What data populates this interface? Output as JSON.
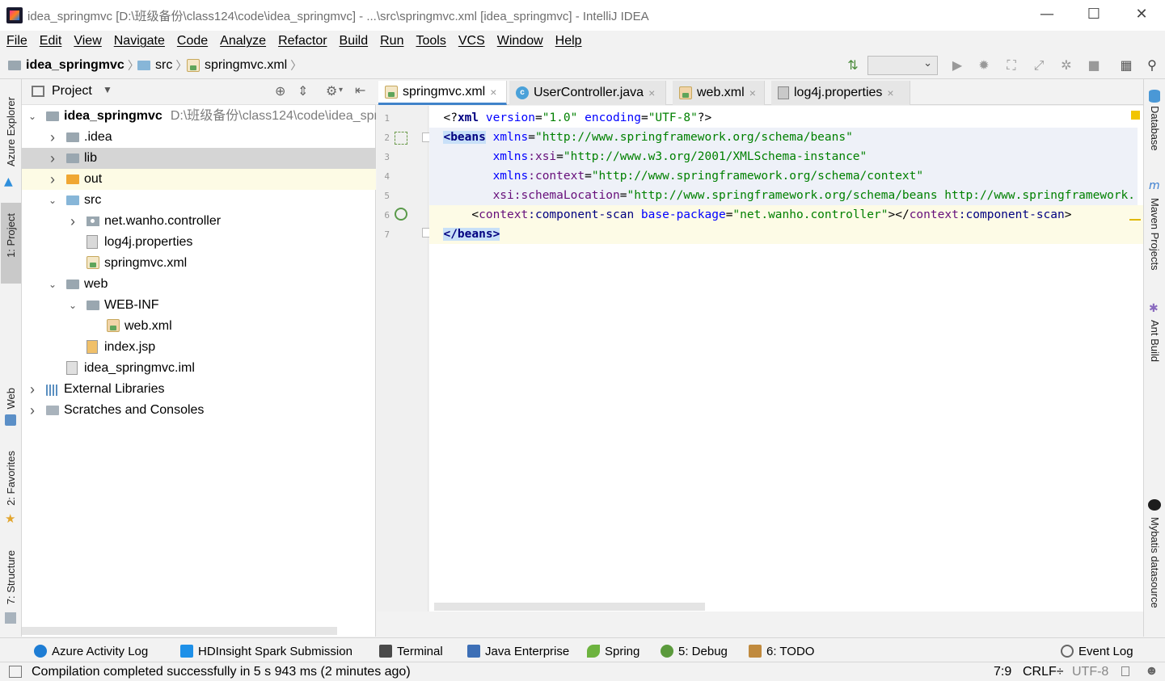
{
  "window": {
    "title": "idea_springmvc [D:\\班级备份\\class124\\code\\idea_springmvc] - ...\\src\\springmvc.xml [idea_springmvc] - IntelliJ IDEA",
    "minimize": "—",
    "maximize": "☐",
    "close": "✕"
  },
  "menu": [
    "File",
    "Edit",
    "View",
    "Navigate",
    "Code",
    "Analyze",
    "Refactor",
    "Build",
    "Run",
    "Tools",
    "VCS",
    "Window",
    "Help"
  ],
  "breadcrumb": [
    "idea_springmvc",
    "src",
    "springmvc.xml"
  ],
  "left_strip": {
    "azure": "Azure Explorer",
    "project": "1: Project",
    "web": "Web",
    "favorites": "2: Favorites",
    "structure": "7: Structure"
  },
  "right_strip": {
    "database": "Database",
    "maven": "Maven Projects",
    "ant": "Ant Build",
    "mybatis": "Mybatis datasource"
  },
  "project_panel": {
    "title": "Project",
    "tree": [
      {
        "label": "idea_springmvc",
        "path": "D:\\班级备份\\class124\\code\\idea_spri",
        "level": 0,
        "arrow": "v",
        "icon": "module"
      },
      {
        "label": ".idea",
        "level": 1,
        "arrow": ">",
        "icon": "folder-grey"
      },
      {
        "label": "lib",
        "level": 1,
        "arrow": ">",
        "icon": "folder-grey"
      },
      {
        "label": "out",
        "level": 1,
        "arrow": ">",
        "icon": "folder-orange"
      },
      {
        "label": "src",
        "level": 1,
        "arrow": "v",
        "icon": "folder-blue"
      },
      {
        "label": "net.wanho.controller",
        "level": 2,
        "arrow": ">",
        "icon": "package"
      },
      {
        "label": "log4j.properties",
        "level": 2,
        "arrow": "",
        "icon": "properties"
      },
      {
        "label": "springmvc.xml",
        "level": 2,
        "arrow": "",
        "icon": "xml"
      },
      {
        "label": "web",
        "level": 1,
        "arrow": "v",
        "icon": "folder-grey"
      },
      {
        "label": "WEB-INF",
        "level": 2,
        "arrow": "v",
        "icon": "folder-grey"
      },
      {
        "label": "web.xml",
        "level": 3,
        "arrow": "",
        "icon": "webxml"
      },
      {
        "label": "index.jsp",
        "level": 2,
        "arrow": "",
        "icon": "jsp"
      },
      {
        "label": "idea_springmvc.iml",
        "level": 1,
        "arrow": "",
        "icon": "iml"
      },
      {
        "label": "External Libraries",
        "level": 0,
        "arrow": ">",
        "icon": "libraries"
      },
      {
        "label": "Scratches and Consoles",
        "level": 0,
        "arrow": ">",
        "icon": "scratches"
      }
    ]
  },
  "editor_tabs": [
    {
      "label": "springmvc.xml",
      "icon": "xml",
      "active": true
    },
    {
      "label": "UserController.java",
      "icon": "class",
      "active": false
    },
    {
      "label": "web.xml",
      "icon": "webxml",
      "active": false
    },
    {
      "label": "log4j.properties",
      "icon": "properties",
      "active": false
    }
  ],
  "class_icon_letter": "c",
  "code": {
    "line_numbers": [
      "1",
      "2",
      "3",
      "4",
      "5",
      "6",
      "7"
    ],
    "l1": {
      "open": "<?",
      "tag": "xml",
      "a1": "version",
      "v1": "\"1.0\"",
      "a2": "encoding",
      "v2": "\"UTF-8\"",
      "close": "?>"
    },
    "l2": {
      "tag": "<beans",
      "attr": "xmlns",
      "val": "\"http://www.springframework.org/schema/beans\""
    },
    "l3": {
      "prefix": "xmlns",
      "attr": ":xsi",
      "val": "\"http://www.w3.org/2001/XMLSchema-instance\""
    },
    "l4": {
      "prefix": "xmlns",
      "attr": ":context",
      "val": "\"http://www.springframework.org/schema/context\""
    },
    "l5": {
      "prefix": "xsi",
      "attr": ":schemaLocation",
      "val": "\"http://www.springframework.org/schema/beans http://www.springframework."
    },
    "l6": {
      "open": "<",
      "prefix": "context",
      "tag": ":component-scan",
      "attr": "base-package",
      "val": "\"net.wanho.controller\"",
      "mid": "></",
      "prefix2": "context",
      "tag2": ":component-scan",
      "close": ">"
    },
    "l7": {
      "tag": "</beans",
      "close": ">"
    }
  },
  "bottom_tabs": [
    {
      "label": "Azure Activity Log",
      "color": "#1e7dd4"
    },
    {
      "label": "HDInsight Spark Submission",
      "color": "#1e90e8"
    },
    {
      "label": "Terminal",
      "color": "#4a4a4a"
    },
    {
      "label": "Java Enterprise",
      "color": "#3d6fb6"
    },
    {
      "label": "Spring",
      "color": "#6db33f"
    },
    {
      "label": "5: Debug",
      "color": "#5b9a3c"
    },
    {
      "label": "6: TODO",
      "color": "#c08a3e"
    }
  ],
  "event_log": "Event Log",
  "status": {
    "message": "Compilation completed successfully in 5 s 943 ms (2 minutes ago)",
    "position": "7:9",
    "line_sep": "CRLF÷",
    "encoding": "UTF-8"
  },
  "colors": {
    "tag": "#000080",
    "attribute": "#0000ff",
    "namespace": "#660e7a",
    "string": "#008000",
    "selection": "#d5d5d5",
    "caret_line": "#fdfbe6"
  }
}
